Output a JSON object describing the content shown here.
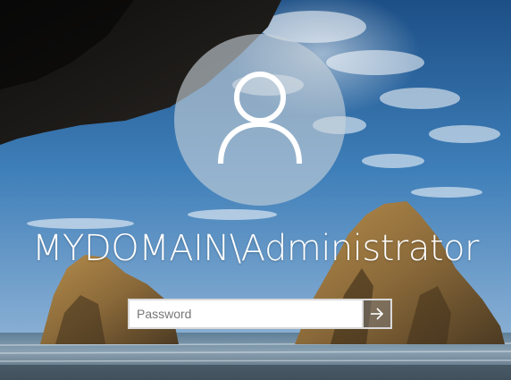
{
  "login": {
    "username": "MYDOMAIN\\Administrator",
    "password_placeholder": "Password",
    "password_value": ""
  },
  "icons": {
    "avatar": "user-silhouette-icon",
    "submit": "arrow-right-icon"
  },
  "colors": {
    "text": "#ffffff",
    "input_border": "#d9d9d9",
    "input_background": "#ffffff",
    "placeholder": "#777777"
  }
}
